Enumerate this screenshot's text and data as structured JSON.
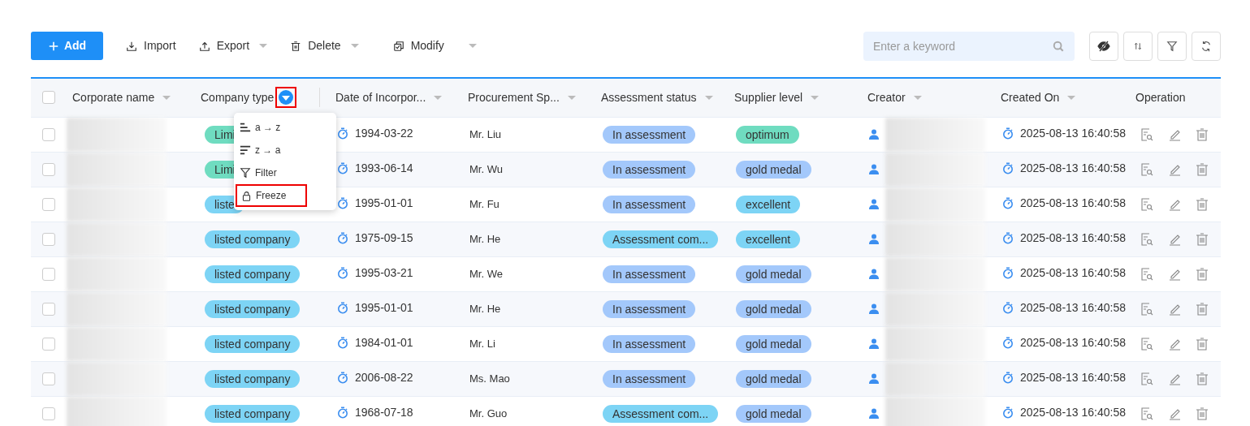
{
  "toolbar": {
    "buttons": [
      {
        "kind": "primary",
        "label": "Add",
        "caret": false
      },
      {
        "kind": "plain",
        "label": "Import",
        "caret": false
      },
      {
        "kind": "plain",
        "label": "Export",
        "caret": true
      },
      {
        "kind": "plain",
        "label": "Delete",
        "caret": true
      },
      {
        "kind": "plain",
        "label": "Modify",
        "caret": true
      }
    ],
    "search": {
      "placeholder": "Enter a keyword"
    },
    "icon_buttons": [
      {
        "kind": "visibility"
      },
      {
        "kind": "sort"
      },
      {
        "kind": "filter"
      },
      {
        "kind": "refresh"
      }
    ]
  },
  "table": {
    "all_checked": false,
    "columns": [
      {
        "label": "Corporate name",
        "menu_open": false
      },
      {
        "label": "Company type",
        "menu_open": true,
        "highlighted": true
      },
      {
        "label": "Date of Incorpor...",
        "menu_open": false
      },
      {
        "label": "Procurement Sp...",
        "menu_open": false
      },
      {
        "label": "Assessment status",
        "menu_open": false
      },
      {
        "label": "Supplier level",
        "menu_open": false
      },
      {
        "label": "Creator",
        "menu_open": false
      },
      {
        "label": "Created On",
        "menu_open": false
      },
      {
        "label": "Operation"
      }
    ],
    "column_menu": [
      {
        "label": "a → z",
        "highlighted": false
      },
      {
        "label": "z → a",
        "highlighted": false
      },
      {
        "label": "Filter",
        "highlighted": false
      },
      {
        "label": "Freeze",
        "highlighted": true
      }
    ],
    "rows": [
      {
        "checked": false,
        "name_blurred": true,
        "type": {
          "label": "Limi",
          "color": "#6fdcc0"
        },
        "date": "1994-03-22",
        "procurement": "Mr. Liu",
        "status": {
          "label": "In assessment",
          "color": "#a3c8fb"
        },
        "level": {
          "label": "optimum",
          "color": "#6fdcc0"
        },
        "creator_blurred": true,
        "created_on": "2025-08-13 16:40:58"
      },
      {
        "checked": false,
        "name_blurred": true,
        "type": {
          "label": "Limi",
          "color": "#6fdcc0"
        },
        "date": "1993-06-14",
        "procurement": "Mr. Wu",
        "status": {
          "label": "In assessment",
          "color": "#a3c8fb"
        },
        "level": {
          "label": "gold medal",
          "color": "#a3c8fb"
        },
        "creator_blurred": true,
        "created_on": "2025-08-13 16:40:58"
      },
      {
        "checked": false,
        "name_blurred": true,
        "type": {
          "label": "liste",
          "color": "#7dd4f5"
        },
        "date": "1995-01-01",
        "procurement": "Mr. Fu",
        "status": {
          "label": "In assessment",
          "color": "#a3c8fb"
        },
        "level": {
          "label": "excellent",
          "color": "#7dd4f5"
        },
        "creator_blurred": true,
        "created_on": "2025-08-13 16:40:58"
      },
      {
        "checked": false,
        "name_blurred": true,
        "type": {
          "label": "listed company",
          "color": "#7dd4f5"
        },
        "date": "1975-09-15",
        "procurement": "Mr. He",
        "status": {
          "label": "Assessment com...",
          "color": "#7dd4f5"
        },
        "level": {
          "label": "excellent",
          "color": "#7dd4f5"
        },
        "creator_blurred": true,
        "created_on": "2025-08-13 16:40:58"
      },
      {
        "checked": false,
        "name_blurred": true,
        "type": {
          "label": "listed company",
          "color": "#7dd4f5"
        },
        "date": "1995-03-21",
        "procurement": "Mr. We",
        "status": {
          "label": "In assessment",
          "color": "#a3c8fb"
        },
        "level": {
          "label": "gold medal",
          "color": "#a3c8fb"
        },
        "creator_blurred": true,
        "created_on": "2025-08-13 16:40:58"
      },
      {
        "checked": false,
        "name_blurred": true,
        "type": {
          "label": "listed company",
          "color": "#7dd4f5"
        },
        "date": "1995-01-01",
        "procurement": "Mr. He",
        "status": {
          "label": "In assessment",
          "color": "#a3c8fb"
        },
        "level": {
          "label": "gold medal",
          "color": "#a3c8fb"
        },
        "creator_blurred": true,
        "created_on": "2025-08-13 16:40:58"
      },
      {
        "checked": false,
        "name_blurred": true,
        "type": {
          "label": "listed company",
          "color": "#7dd4f5"
        },
        "date": "1984-01-01",
        "procurement": "Mr. Li",
        "status": {
          "label": "In assessment",
          "color": "#a3c8fb"
        },
        "level": {
          "label": "gold medal",
          "color": "#a3c8fb"
        },
        "creator_blurred": true,
        "created_on": "2025-08-13 16:40:58"
      },
      {
        "checked": false,
        "name_blurred": true,
        "type": {
          "label": "listed company",
          "color": "#7dd4f5"
        },
        "date": "2006-08-22",
        "procurement": "Ms. Mao",
        "status": {
          "label": "In assessment",
          "color": "#a3c8fb"
        },
        "level": {
          "label": "gold medal",
          "color": "#a3c8fb"
        },
        "creator_blurred": true,
        "created_on": "2025-08-13 16:40:58"
      },
      {
        "checked": false,
        "name_blurred": true,
        "type": {
          "label": "listed company",
          "color": "#7dd4f5"
        },
        "date": "1968-07-18",
        "procurement": "Mr. Guo",
        "status": {
          "label": "Assessment com...",
          "color": "#7dd4f5"
        },
        "level": {
          "label": "gold medal",
          "color": "#a3c8fb"
        },
        "creator_blurred": true,
        "created_on": "2025-08-13 16:40:58"
      }
    ]
  }
}
